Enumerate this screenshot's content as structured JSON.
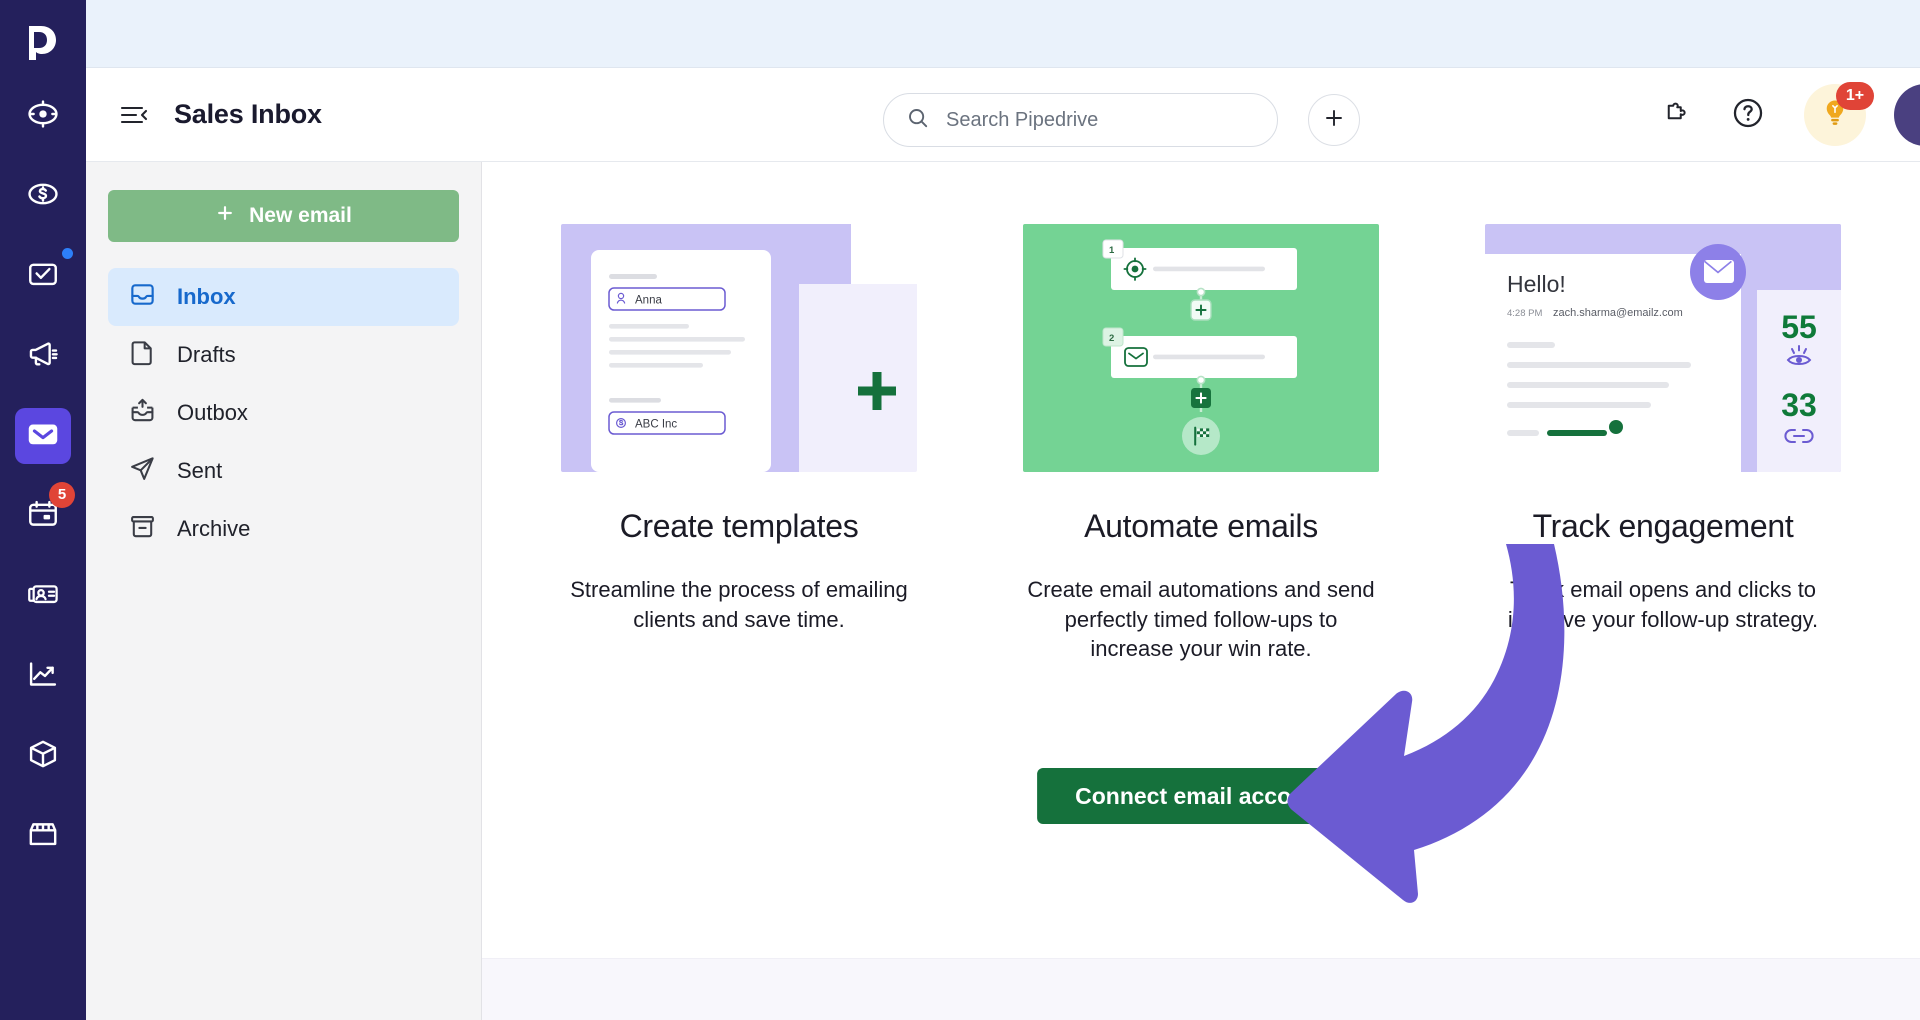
{
  "app": {
    "name": "Pipedrive"
  },
  "rail": {
    "logo_icon": "pipedrive-logo",
    "items": [
      {
        "name": "leads-inbox",
        "icon": "target-icon",
        "badge": null,
        "dot": false,
        "active": false
      },
      {
        "name": "deals",
        "icon": "dollar-circle-icon",
        "badge": null,
        "dot": false,
        "active": false
      },
      {
        "name": "activities",
        "icon": "checkbox-calendar-icon",
        "badge": null,
        "dot": true,
        "active": false
      },
      {
        "name": "campaigns",
        "icon": "megaphone-icon",
        "badge": null,
        "dot": false,
        "active": false
      },
      {
        "name": "mail",
        "icon": "envelope-icon",
        "badge": null,
        "dot": false,
        "active": true
      },
      {
        "name": "calendar",
        "icon": "calendar-icon",
        "badge": "5",
        "dot": false,
        "active": false
      },
      {
        "name": "contacts",
        "icon": "contact-card-icon",
        "badge": null,
        "dot": false,
        "active": false
      },
      {
        "name": "insights",
        "icon": "trending-up-icon",
        "badge": null,
        "dot": false,
        "active": false
      },
      {
        "name": "products",
        "icon": "box-icon",
        "badge": null,
        "dot": false,
        "active": false
      },
      {
        "name": "marketplace",
        "icon": "storefront-icon",
        "badge": null,
        "dot": false,
        "active": false
      }
    ]
  },
  "topbar": {
    "menu_icon": "hamburger-collapse-icon",
    "title": "Sales Inbox",
    "search": {
      "placeholder": "Search Pipedrive",
      "value": "",
      "icon": "search-icon"
    },
    "add_button_icon": "plus-icon",
    "apps_icon": "puzzle-piece-icon",
    "help_icon": "question-circle-icon",
    "tips": {
      "icon": "lightbulb-icon",
      "badge": "1+"
    },
    "avatar": "user-avatar"
  },
  "mail_sidebar": {
    "new_email_label": "New email",
    "new_email_icon": "plus-icon",
    "folders": [
      {
        "label": "Inbox",
        "icon": "inbox-tray-icon",
        "active": true
      },
      {
        "label": "Drafts",
        "icon": "document-icon",
        "active": false
      },
      {
        "label": "Outbox",
        "icon": "outbox-tray-icon",
        "active": false
      },
      {
        "label": "Sent",
        "icon": "paper-plane-icon",
        "active": false
      },
      {
        "label": "Archive",
        "icon": "archive-box-icon",
        "active": false
      }
    ]
  },
  "main": {
    "cards": [
      {
        "title": "Create templates",
        "description": "Streamline the process of emailing clients and save time.",
        "art": {
          "kind": "template-composer",
          "bg": "#c9c3f5",
          "field_person": {
            "label": "Anna",
            "icon": "person-icon"
          },
          "field_org": {
            "label": "ABC Inc",
            "icon": "dollar-circle-icon"
          },
          "plus_icon": "plus-icon"
        }
      },
      {
        "title": "Automate emails",
        "description": "Create email automations and send perfectly timed follow-ups to increase your win rate.",
        "art": {
          "kind": "automation-flow",
          "bg": "#74d394",
          "steps": [
            {
              "number": "1",
              "icon": "target-icon"
            },
            {
              "number": "2",
              "icon": "envelope-icon"
            }
          ],
          "add_icons": [
            "plus-icon",
            "plus-icon"
          ],
          "end_icon": "checkered-flag-icon"
        }
      },
      {
        "title": "Track engagement",
        "description": "Track email opens and clicks to improve your follow-up strategy.",
        "art": {
          "kind": "engagement-preview",
          "bg": "#c9c3f5",
          "greeting": "Hello!",
          "time": "4:28 PM",
          "email": "zach.sharma@emailz.com",
          "envelope_icon": "envelope-icon",
          "stats": [
            {
              "value": "55",
              "icon": "eye-icon"
            },
            {
              "value": "33",
              "icon": "link-icon"
            }
          ]
        }
      }
    ],
    "cta_label": "Connect email account",
    "annotation_icon": "curved-arrow-annotation"
  },
  "colors": {
    "rail_bg": "#24205c",
    "rail_active": "#5b47e0",
    "brand_green": "#15713c",
    "new_email_green": "#7fba86",
    "active_folder_bg": "#d9eafd",
    "active_folder_text": "#1769cc",
    "badge_red": "#e04437",
    "annotation_purple": "#6b5bd2",
    "topstrip_blue": "#eaf2fb"
  }
}
